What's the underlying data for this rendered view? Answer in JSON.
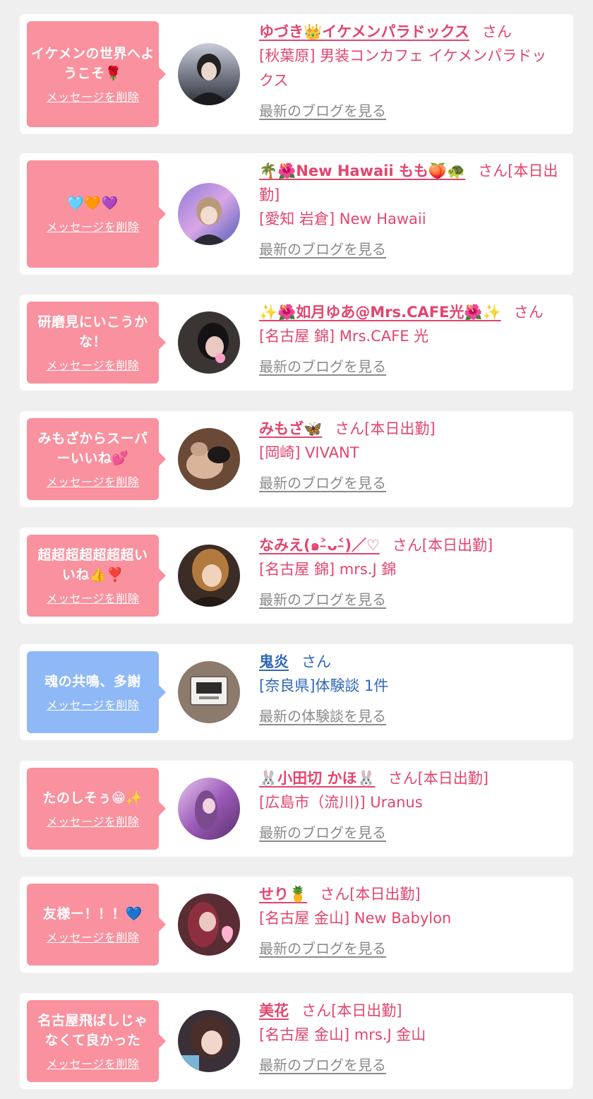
{
  "items": [
    {
      "message": "イケメンの世界へようこそ🌹",
      "delete_label": "メッセージを削除",
      "name": "ゆづき👑イケメンパラドックス",
      "suffix": "さん",
      "shop": "[秋葉原] 男装コンカフェ イケメンパラドックス",
      "link": "最新のブログを見る",
      "bubble_color": "#f9919e"
    },
    {
      "message": "🩵🧡💜",
      "delete_label": "メッセージを削除",
      "name": "🌴🌺New Hawaii もも🍑🐢",
      "suffix": "さん[本日出勤]",
      "shop": "[愛知 岩倉] New Hawaii",
      "link": "最新のブログを見る",
      "bubble_color": "#f9919e"
    },
    {
      "message": "研磨見にいこうかな！",
      "delete_label": "メッセージを削除",
      "name": "✨🌺如月ゆあ@Mrs.CAFE光🌺✨",
      "suffix": "さん",
      "shop": "[名古屋 錦] Mrs.CAFE 光",
      "link": "最新のブログを見る",
      "bubble_color": "#f9919e"
    },
    {
      "message": "みもざからスーパーいいね💕",
      "delete_label": "メッセージを削除",
      "name": "みもざ🦋",
      "suffix": "さん[本日出勤]",
      "shop": "[岡崎] VIVANT",
      "link": "最新のブログを見る",
      "bubble_color": "#f9919e"
    },
    {
      "message": "超超超超超超超いいね👍❣️",
      "delete_label": "メッセージを削除",
      "name": "なみえ(๑˃̵ᴗ˂̵)／♡",
      "suffix": "さん[本日出勤]",
      "shop": "[名古屋 錦] mrs.J 錦",
      "link": "最新のブログを見る",
      "bubble_color": "#f9919e"
    },
    {
      "message": "魂の共鳴、多謝",
      "delete_label": "メッセージを削除",
      "name": "鬼炎",
      "suffix": "さん",
      "shop": "[奈良県]体験談 1件",
      "link": "最新の体験談を見る",
      "bubble_color": "#8fb8f6"
    },
    {
      "message": "たのしそぅ😁✨",
      "delete_label": "メッセージを削除",
      "name": "🐰小田切 かほ🐰",
      "suffix": "さん[本日出勤]",
      "shop": "[広島市（流川)] Uranus",
      "link": "最新のブログを見る",
      "bubble_color": "#f9919e"
    },
    {
      "message": "友様ー！！！💙",
      "delete_label": "メッセージを削除",
      "name": "せり🍍",
      "suffix": "さん[本日出勤]",
      "shop": "[名古屋 金山] New Babylon",
      "link": "最新のブログを見る",
      "bubble_color": "#f9919e"
    },
    {
      "message": "名古屋飛ばしじゃなくて良かった",
      "delete_label": "メッセージを削除",
      "name": "美花",
      "suffix": "さん[本日出勤]",
      "shop": "[名古屋 金山] mrs.J 金山",
      "link": "最新のブログを見る",
      "bubble_color": "#f9919e"
    }
  ]
}
